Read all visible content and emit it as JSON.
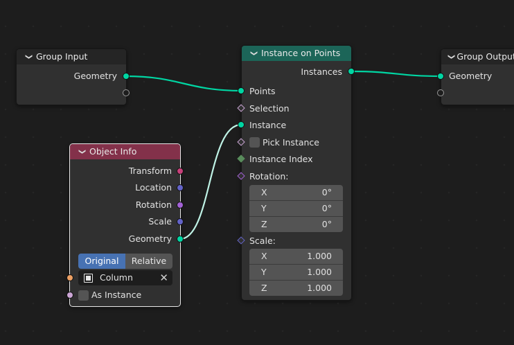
{
  "nodes": {
    "group_input": {
      "title": "Group Input",
      "outputs": [
        "Geometry"
      ]
    },
    "instance_on_points": {
      "title": "Instance on Points",
      "outputs": [
        "Instances"
      ],
      "inputs": {
        "points": "Points",
        "selection": "Selection",
        "instance": "Instance",
        "pick_instance": "Pick Instance",
        "instance_index": "Instance Index",
        "rotation": "Rotation:",
        "rotation_values": [
          {
            "axis": "X",
            "value": "0°"
          },
          {
            "axis": "Y",
            "value": "0°"
          },
          {
            "axis": "Z",
            "value": "0°"
          }
        ],
        "scale": "Scale:",
        "scale_values": [
          {
            "axis": "X",
            "value": "1.000"
          },
          {
            "axis": "Y",
            "value": "1.000"
          },
          {
            "axis": "Z",
            "value": "1.000"
          }
        ]
      }
    },
    "group_output": {
      "title": "Group Output",
      "inputs": [
        "Geometry"
      ]
    },
    "object_info": {
      "title": "Object Info",
      "outputs": [
        "Transform",
        "Location",
        "Rotation",
        "Scale",
        "Geometry"
      ],
      "transform_space": {
        "options": [
          "Original",
          "Relative"
        ],
        "selected": "Original"
      },
      "object_field": "Column",
      "as_instance": "As Instance"
    }
  },
  "colors": {
    "geometry_socket": "#00d6a3",
    "vector_socket": "#6363c7",
    "rotation_socket": "#a362d6",
    "matrix_socket": "#c7407a",
    "object_socket": "#eda064",
    "boolean_socket": "#cca6d6",
    "integer_socket": "#598c5c",
    "geometry_header": "#1c6558",
    "input_header": "#83314a"
  }
}
